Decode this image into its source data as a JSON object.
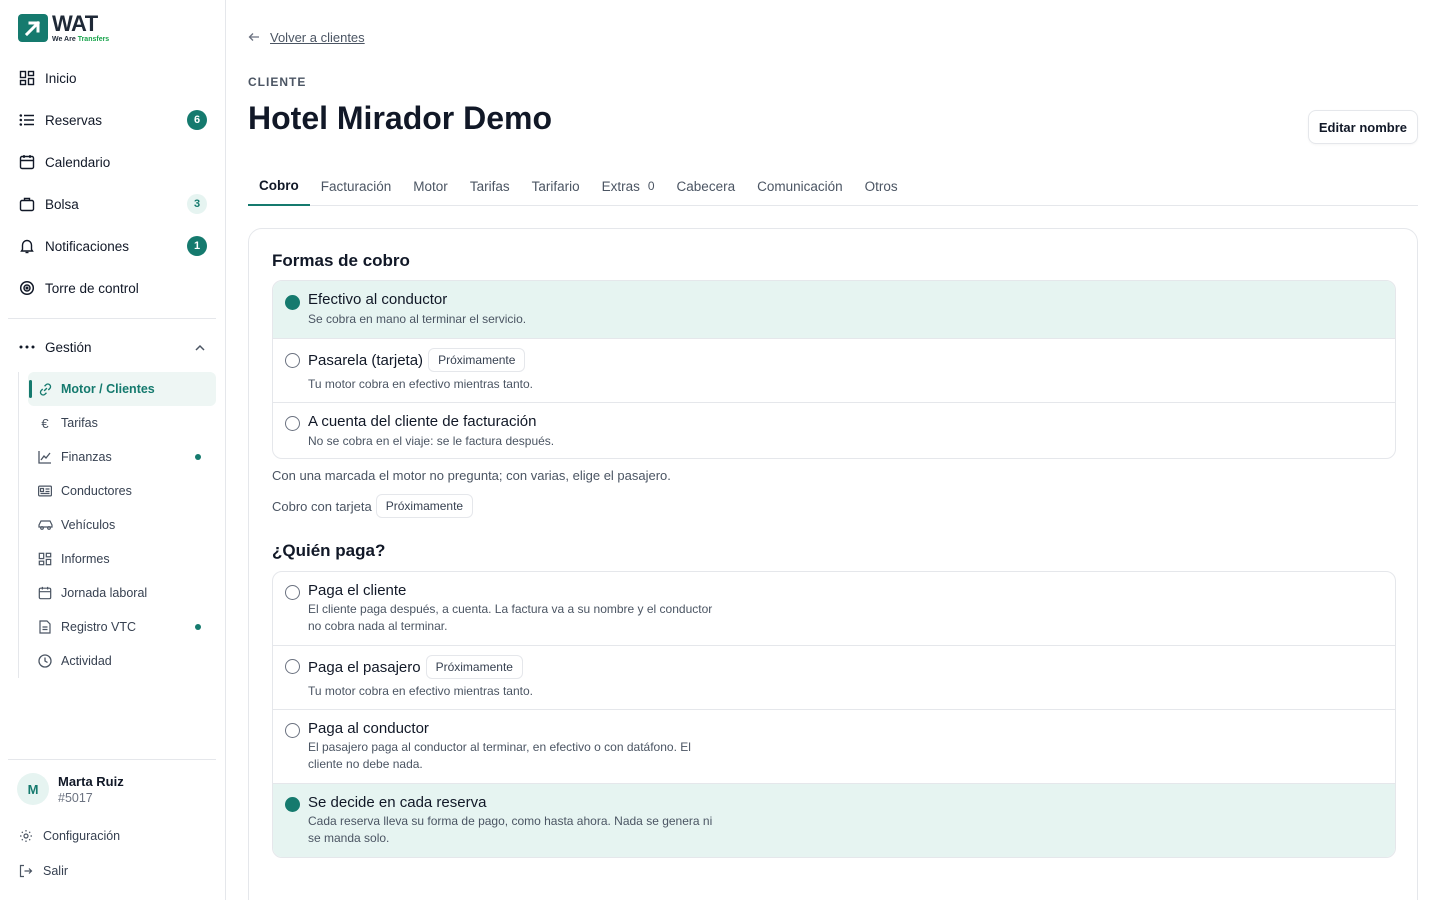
{
  "brand": {
    "name": "WAT",
    "tag_prefix": "We Are",
    "tag_suffix": "Transfers"
  },
  "sidebar": {
    "nav": [
      {
        "label": "Inicio",
        "icon": "grid-icon"
      },
      {
        "label": "Reservas",
        "icon": "list-icon",
        "badge": "6"
      },
      {
        "label": "Calendario",
        "icon": "calendar-icon"
      },
      {
        "label": "Bolsa",
        "icon": "bag-icon",
        "badge": "3"
      },
      {
        "label": "Notificaciones",
        "icon": "bell-icon",
        "badge": "1"
      },
      {
        "label": "Torre de control",
        "icon": "target-icon"
      }
    ],
    "group": {
      "label": "Gestión",
      "icon": "more-dots-icon"
    },
    "sub_items": [
      {
        "label": "Motor / Clientes",
        "icon": "link-icon"
      },
      {
        "label": "Tarifas",
        "icon": "euro-icon"
      },
      {
        "label": "Finanzas",
        "icon": "chart-icon"
      },
      {
        "label": "Conductores",
        "icon": "id-card-icon"
      },
      {
        "label": "Vehículos",
        "icon": "car-icon"
      },
      {
        "label": "Informes",
        "icon": "grid-icon"
      },
      {
        "label": "Jornada laboral",
        "icon": "calendar-icon"
      },
      {
        "label": "Registro VTC",
        "icon": "document-icon"
      },
      {
        "label": "Actividad",
        "icon": "clock-icon"
      }
    ],
    "user": {
      "initial": "M",
      "name": "Marta Ruiz",
      "id": "#5017"
    },
    "footer": {
      "settings": "Configuración",
      "logout": "Salir"
    }
  },
  "main": {
    "back": "Volver a clientes",
    "eyebrow": "CLIENTE",
    "title": "Hotel Mirador Demo",
    "edit_button": "Editar nombre",
    "tabs": [
      {
        "label": "Cobro"
      },
      {
        "label": "Facturación"
      },
      {
        "label": "Motor"
      },
      {
        "label": "Tarifas"
      },
      {
        "label": "Tarifario"
      },
      {
        "label": "Extras",
        "count": "0"
      },
      {
        "label": "Cabecera"
      },
      {
        "label": "Comunicación"
      },
      {
        "label": "Otros"
      }
    ],
    "cobro": {
      "title": "Formas de cobro",
      "options": [
        {
          "title": "Efectivo al conductor",
          "desc": "Se cobra en mano al terminar el servicio.",
          "selected": true
        },
        {
          "title": "Pasarela (tarjeta)",
          "pill": "Próximamente",
          "desc": "Tu motor cobra en efectivo mientras tanto.",
          "selected": false
        },
        {
          "title": "A cuenta del cliente de facturación",
          "desc": "No se cobra en el viaje: se le factura después.",
          "selected": false
        }
      ],
      "note": "Con una marcada el motor no pregunta; con varias, elige el pasajero.",
      "card_label": "Cobro con tarjeta",
      "card_pill": "Próximamente"
    },
    "payer": {
      "title": "¿Quién paga?",
      "options": [
        {
          "title": "Paga el cliente",
          "desc1": "El cliente paga después, a cuenta. La factura va a su nombre y el conductor",
          "desc2": "no cobra nada al terminar.",
          "selected": false
        },
        {
          "title": "Paga el pasajero",
          "pill": "Próximamente",
          "desc1": "Tu motor cobra en efectivo mientras tanto.",
          "selected": false
        },
        {
          "title": "Paga al conductor",
          "desc1": "El pasajero paga al conductor al terminar, en efectivo o con datáfono. El",
          "desc2": "cliente no debe nada.",
          "selected": false
        },
        {
          "title": "Se decide en cada reserva",
          "desc1": "Cada reserva lleva su forma de pago, como hasta ahora. Nada se genera ni",
          "desc2": "se manda solo.",
          "selected": true
        }
      ]
    }
  },
  "colors": {
    "accent": "#157a6e",
    "selected_bg": "#e6f4f1",
    "border": "#e5e7eb"
  }
}
